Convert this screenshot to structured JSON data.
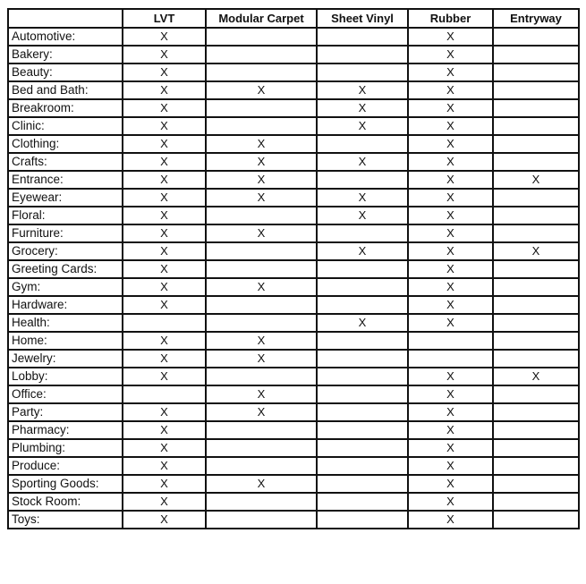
{
  "table": {
    "columns": [
      "",
      "LVT",
      "Modular Carpet",
      "Sheet Vinyl",
      "Rubber",
      "Entryway"
    ],
    "mark_symbol": "X",
    "rows": [
      {
        "label": "Automotive:",
        "cells": [
          "X",
          "",
          "",
          "X",
          ""
        ]
      },
      {
        "label": "Bakery:",
        "cells": [
          "X",
          "",
          "",
          "X",
          ""
        ]
      },
      {
        "label": "Beauty:",
        "cells": [
          "X",
          "",
          "",
          "X",
          ""
        ]
      },
      {
        "label": "Bed and Bath:",
        "cells": [
          "X",
          "X",
          "X",
          "X",
          ""
        ]
      },
      {
        "label": "Breakroom:",
        "cells": [
          "X",
          "",
          "X",
          "X",
          ""
        ]
      },
      {
        "label": "Clinic:",
        "cells": [
          "X",
          "",
          "X",
          "X",
          ""
        ]
      },
      {
        "label": "Clothing:",
        "cells": [
          "X",
          "X",
          "",
          "X",
          ""
        ]
      },
      {
        "label": "Crafts:",
        "cells": [
          "X",
          "X",
          "X",
          "X",
          ""
        ]
      },
      {
        "label": "Entrance:",
        "cells": [
          "X",
          "X",
          "",
          "X",
          "X"
        ]
      },
      {
        "label": "Eyewear:",
        "cells": [
          "X",
          "X",
          "X",
          "X",
          ""
        ]
      },
      {
        "label": "Floral:",
        "cells": [
          "X",
          "",
          "X",
          "X",
          ""
        ]
      },
      {
        "label": "Furniture:",
        "cells": [
          "X",
          "X",
          "",
          "X",
          ""
        ]
      },
      {
        "label": "Grocery:",
        "cells": [
          "X",
          "",
          "X",
          "X",
          "X"
        ]
      },
      {
        "label": "Greeting Cards:",
        "cells": [
          "X",
          "",
          "",
          "X",
          ""
        ]
      },
      {
        "label": "Gym:",
        "cells": [
          "X",
          "X",
          "",
          "X",
          ""
        ]
      },
      {
        "label": "Hardware:",
        "cells": [
          "X",
          "",
          "",
          "X",
          ""
        ]
      },
      {
        "label": "Health:",
        "cells": [
          "",
          "",
          "X",
          "X",
          ""
        ]
      },
      {
        "label": "Home:",
        "cells": [
          "X",
          "X",
          "",
          "",
          ""
        ]
      },
      {
        "label": "Jewelry:",
        "cells": [
          "X",
          "X",
          "",
          "",
          ""
        ]
      },
      {
        "label": "Lobby:",
        "cells": [
          "X",
          "",
          "",
          "X",
          "X"
        ]
      },
      {
        "label": "Office:",
        "cells": [
          "",
          "X",
          "",
          "X",
          ""
        ]
      },
      {
        "label": "Party:",
        "cells": [
          "X",
          "X",
          "",
          "X",
          ""
        ]
      },
      {
        "label": "Pharmacy:",
        "cells": [
          "X",
          "",
          "",
          "X",
          ""
        ]
      },
      {
        "label": "Plumbing:",
        "cells": [
          "X",
          "",
          "",
          "X",
          ""
        ]
      },
      {
        "label": "Produce:",
        "cells": [
          "X",
          "",
          "",
          "X",
          ""
        ]
      },
      {
        "label": "Sporting Goods:",
        "cells": [
          "X",
          "X",
          "",
          "X",
          ""
        ]
      },
      {
        "label": "Stock Room:",
        "cells": [
          "X",
          "",
          "",
          "X",
          ""
        ]
      },
      {
        "label": "Toys:",
        "cells": [
          "X",
          "",
          "",
          "X",
          ""
        ]
      }
    ]
  }
}
